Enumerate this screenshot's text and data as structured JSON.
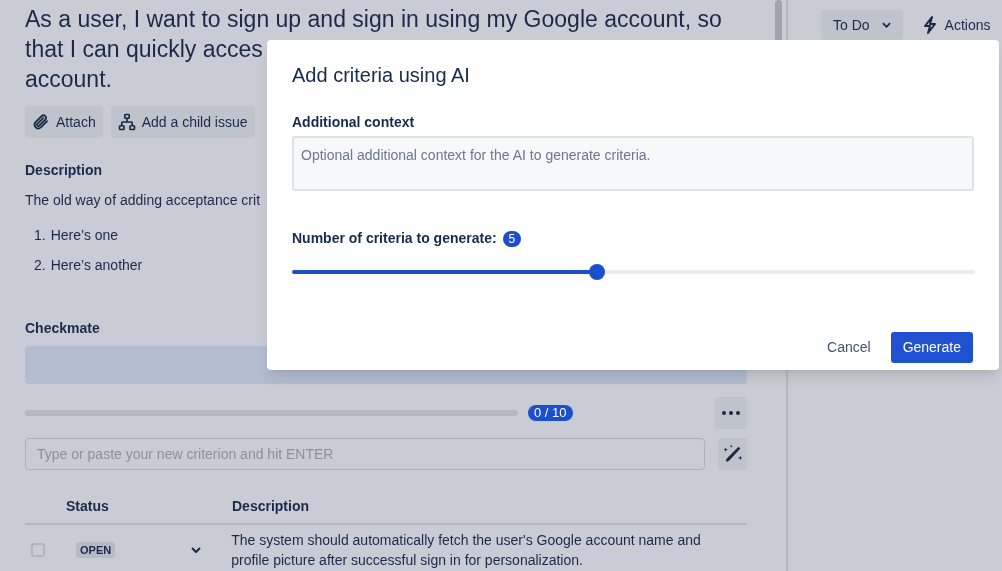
{
  "issue": {
    "title_lines": [
      "As a user, I want to sign up and sign in using my Google account, so",
      "that I can quickly acces",
      "account."
    ],
    "actions": [
      {
        "kind": "attach",
        "label": "Attach"
      },
      {
        "kind": "child",
        "label": "Add a child issue"
      }
    ],
    "description_heading": "Description",
    "description": "The old way of adding acceptance crit",
    "list": [
      "Here’s one",
      "Here’s another"
    ],
    "list_numbers": [
      "1.",
      "2."
    ]
  },
  "checkmate": {
    "heading": "Checkmate",
    "progress": {
      "level": 0,
      "reading": "0 / 10"
    },
    "input": {
      "placeholder": "Type or paste your new criterion and hit ENTER"
    },
    "table": {
      "columns": [
        "Status",
        "Description"
      ],
      "rows": [
        {
          "checked": false,
          "status": "OPEN",
          "description": "The system should automatically fetch the user's Google account name and profile picture after successful sign in for personalization."
        }
      ]
    }
  },
  "side": {
    "status_button": "To Do",
    "actions_button": "Actions"
  },
  "dialog": {
    "title": "Add criteria using AI",
    "context_label": "Additional context",
    "context_placeholder": "Optional additional context for the AI to generate criteria.",
    "count_label": "Number of criteria to generate:",
    "count": "5",
    "slider": {
      "level": 0.447
    },
    "buttons": [
      {
        "kind": "subtle",
        "label": "Cancel"
      },
      {
        "kind": "primary",
        "label": "Generate"
      }
    ]
  }
}
